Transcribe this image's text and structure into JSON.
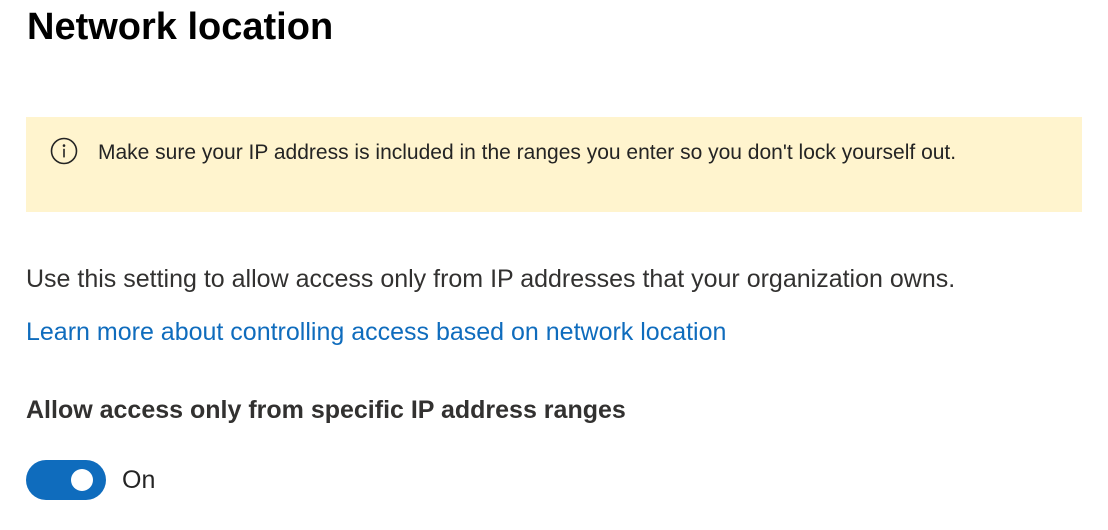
{
  "page": {
    "title": "Network location"
  },
  "notice": {
    "icon": "info-icon",
    "text": "Make sure your IP address is included in the ranges you enter so you don't lock yourself out.",
    "background_color": "#fff4ce"
  },
  "description": "Use this setting to allow access only from IP addresses that your organization owns.",
  "learn_more_link": {
    "text": "Learn more about controlling access based on network location",
    "color": "#0f6cbd"
  },
  "ip_restriction": {
    "label": "Allow access only from specific IP address ranges",
    "toggle_state": true,
    "toggle_text": "On",
    "toggle_color": "#0f6cbd"
  }
}
